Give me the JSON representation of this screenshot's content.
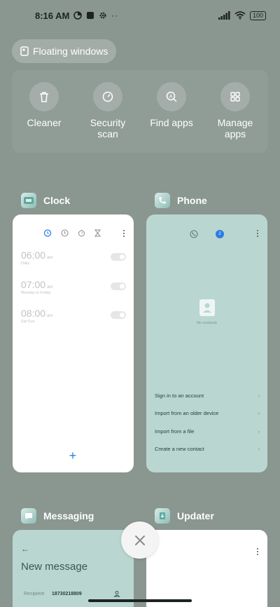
{
  "status_bar": {
    "time": "8:16 AM",
    "battery": "100"
  },
  "floating_windows": {
    "label": "Floating windows"
  },
  "tools": [
    {
      "label": "Cleaner",
      "icon": "trash-icon"
    },
    {
      "label": "Security scan",
      "icon": "shield-check-icon"
    },
    {
      "label": "Find apps",
      "icon": "search-apps-icon"
    },
    {
      "label": "Manage apps",
      "icon": "grid-icon"
    }
  ],
  "apps": {
    "clock": {
      "name": "Clock",
      "alarms": [
        {
          "time": "06:00",
          "ampm": "am",
          "days": "Daily"
        },
        {
          "time": "07:00",
          "ampm": "am",
          "days": "Monday to Friday"
        },
        {
          "time": "08:00",
          "ampm": "am",
          "days": "Sat Sun"
        }
      ],
      "add_label": "+"
    },
    "phone": {
      "name": "Phone",
      "empty": "No contacts",
      "badge": "2",
      "rows": [
        "Sign in to an account",
        "Import from an older device",
        "Import from a file",
        "Create a new contact"
      ]
    },
    "messaging": {
      "name": "Messaging",
      "title": "New message",
      "recipient_label": "Recipient",
      "recipient_value": "18730218809"
    },
    "updater": {
      "name": "Updater"
    }
  },
  "colors": {
    "background": "#8a9690",
    "accent": "#2b7de6",
    "card_tint": "#b9d7d0"
  }
}
